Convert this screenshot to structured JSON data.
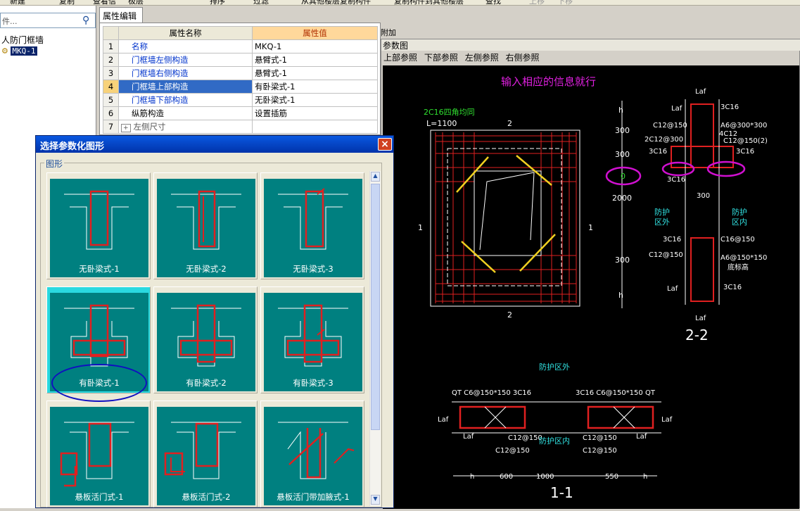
{
  "toolbar": {
    "items": [
      "新建",
      "复制",
      "查看信",
      "极层",
      "排序",
      "过滤",
      "从其他楼层复制构件",
      "复制构件到其他楼层",
      "查找",
      "上移",
      "下移"
    ]
  },
  "sidebar": {
    "search_placeholder": "件...",
    "tree_root": "人防门框墙",
    "tree_item": "MKQ-1"
  },
  "property_editor": {
    "tab": "属性编辑",
    "header_name": "属性名称",
    "header_value": "属性值",
    "rows": [
      {
        "num": "1",
        "name": "名称",
        "value": "MKQ-1"
      },
      {
        "num": "2",
        "name": "门框墙左侧构造",
        "value": "悬臂式-1"
      },
      {
        "num": "3",
        "name": "门框墙右侧构造",
        "value": "悬臂式-1"
      },
      {
        "num": "4",
        "name": "门框墙上部构造",
        "value": "有卧梁式-1"
      },
      {
        "num": "5",
        "name": "门框墙下部构造",
        "value": "无卧梁式-1"
      },
      {
        "num": "6",
        "name": "纵筋构造",
        "value": "设置插筋"
      },
      {
        "num": "7",
        "name": "左侧尺寸",
        "value": ""
      }
    ],
    "expander": "+"
  },
  "param_panel": {
    "side_label": "附加",
    "title": "参数图",
    "tabs": [
      "上部参照",
      "下部参照",
      "左侧参照",
      "右侧参照"
    ],
    "drawing": {
      "heading": "输入相应的信息就行",
      "labels": {
        "top_rebar": "2C16四角均同",
        "length": "L=1100",
        "sec_2": "2",
        "sec_1": "1",
        "h": "h",
        "d300": "300",
        "d0": "0",
        "d2000": "2000",
        "laf": "Laf",
        "c16_3": "3C16",
        "c12_150": "C12@150",
        "a6": "A6@300*300",
        "c12_4": "4C12",
        "c12_300": "2C12@300",
        "c12_150_2": "C12@150(2)",
        "protect_out": "防护\n区外",
        "protect_in": "防护\n区内",
        "c16_150": "C16@150",
        "a6_150": "A6@150*150",
        "bottom_elev": "底标高",
        "title_22": "2-2",
        "title_11": "1-1",
        "protect_out_h": "防护区外",
        "protect_in_h": "防护区内",
        "qt_left": "QT C6@150*150  3C16",
        "qt_right": "3C16  C6@150*150 QT",
        "dim_600": "600",
        "dim_1000": "1000",
        "dim_550": "550"
      }
    }
  },
  "dialog": {
    "title": "选择参数化图形",
    "group_label": "图形",
    "close": "×",
    "shapes": [
      "无卧梁式-1",
      "无卧梁式-2",
      "无卧梁式-3",
      "有卧梁式-1",
      "有卧梁式-2",
      "有卧梁式-3",
      "悬板活门式-1",
      "悬板活门式-2",
      "悬板活门带加腋式-1"
    ],
    "selected": "有卧梁式-1"
  },
  "colors": {
    "tile": "#008080",
    "selection": "#2ad9e0",
    "highlight_row": "#316ac5",
    "annotation_oval": "#d010d0",
    "blue_oval": "#1010c0"
  }
}
